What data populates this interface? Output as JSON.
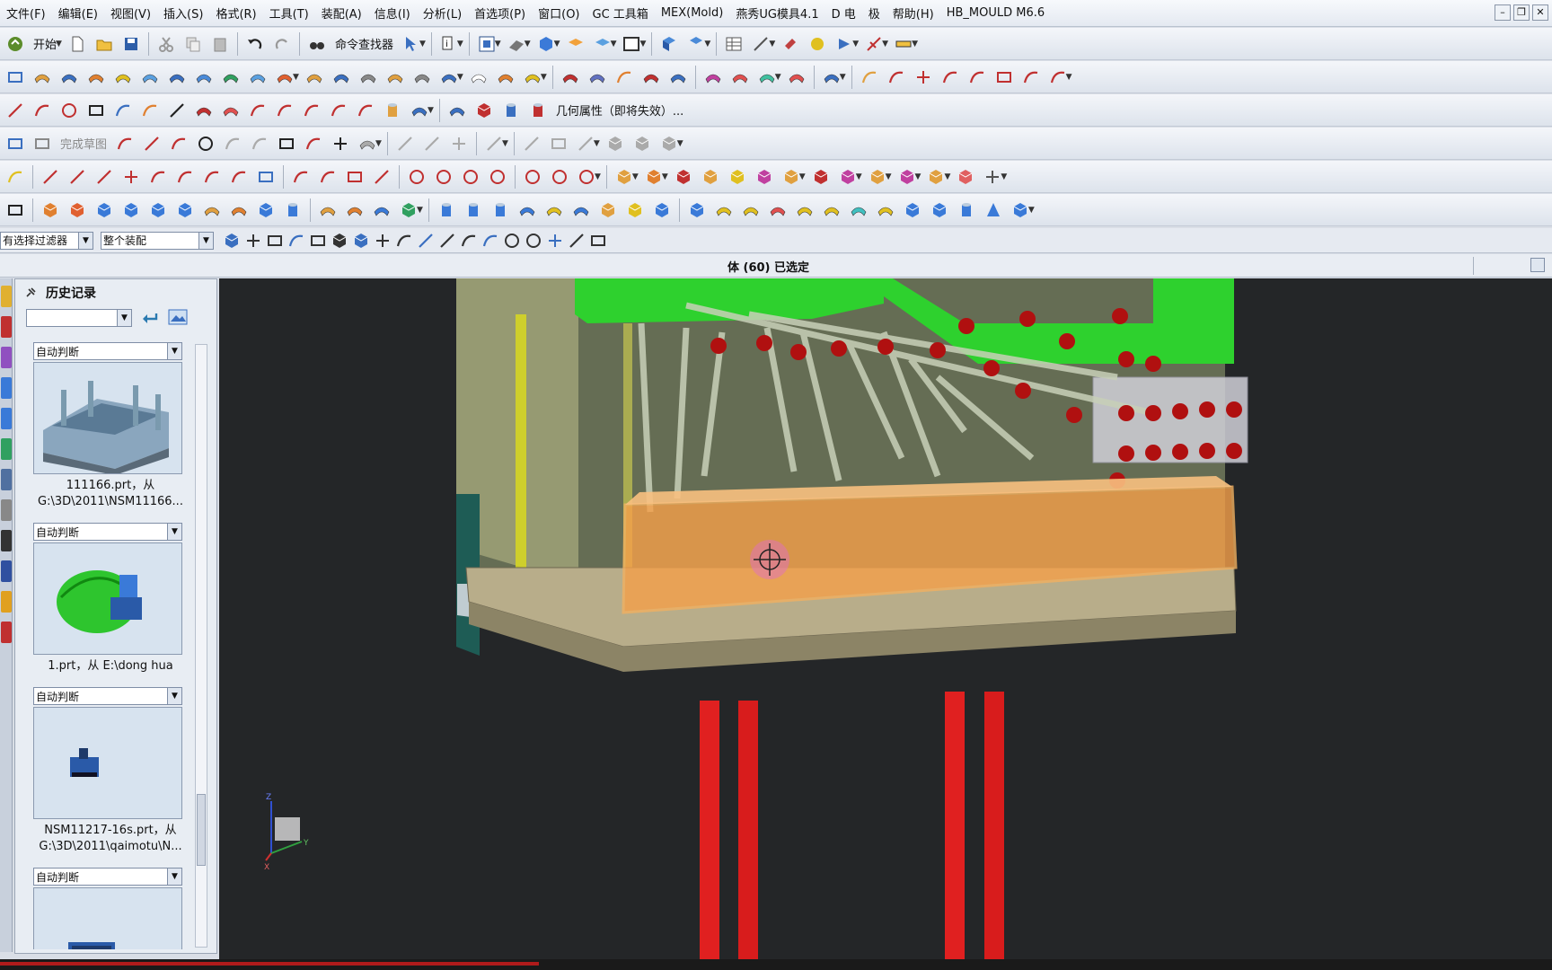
{
  "menubar": {
    "items": [
      "文件(F)",
      "编辑(E)",
      "视图(V)",
      "插入(S)",
      "格式(R)",
      "工具(T)",
      "装配(A)",
      "信息(I)",
      "分析(L)",
      "首选项(P)",
      "窗口(O)",
      "GC 工具箱",
      "MEX(Mold)",
      "燕秀UG模具4.1",
      "D 电",
      "极",
      "帮助(H)",
      "HB_MOULD M6.6"
    ]
  },
  "toolbar": {
    "start_label": "开始",
    "command_finder_label": "命令查找器",
    "geometry_props_label": "几何属性（即将失效）...",
    "finish_sketch_label": "完成草图"
  },
  "selection": {
    "filter_value": "有选择过滤器",
    "scope_value": "整个装配"
  },
  "status": {
    "text": "体 (60) 已选定"
  },
  "history": {
    "title": "历史记录",
    "items": [
      {
        "mode": "自动判断",
        "line1": "111166.prt，从",
        "line2": "G:\\3D\\2011\\NSM11166..."
      },
      {
        "mode": "自动判断",
        "line1": "1.prt，从 E:\\dong hua",
        "line2": ""
      },
      {
        "mode": "自动判断",
        "line1": "NSM11217-16s.prt，从",
        "line2": "G:\\3D\\2011\\qaimotu\\N..."
      },
      {
        "mode": "自动判断",
        "line1": "",
        "line2": ""
      }
    ]
  },
  "viewport": {
    "background": "#242628",
    "triad": {
      "z": "Z",
      "y": "Y",
      "x": "X"
    }
  },
  "colors": {
    "green_plate": "#2ed12e",
    "orange_selected": "#f5a04a",
    "red_pillars": "#e02020",
    "base_plate": "#b8ad8a"
  }
}
